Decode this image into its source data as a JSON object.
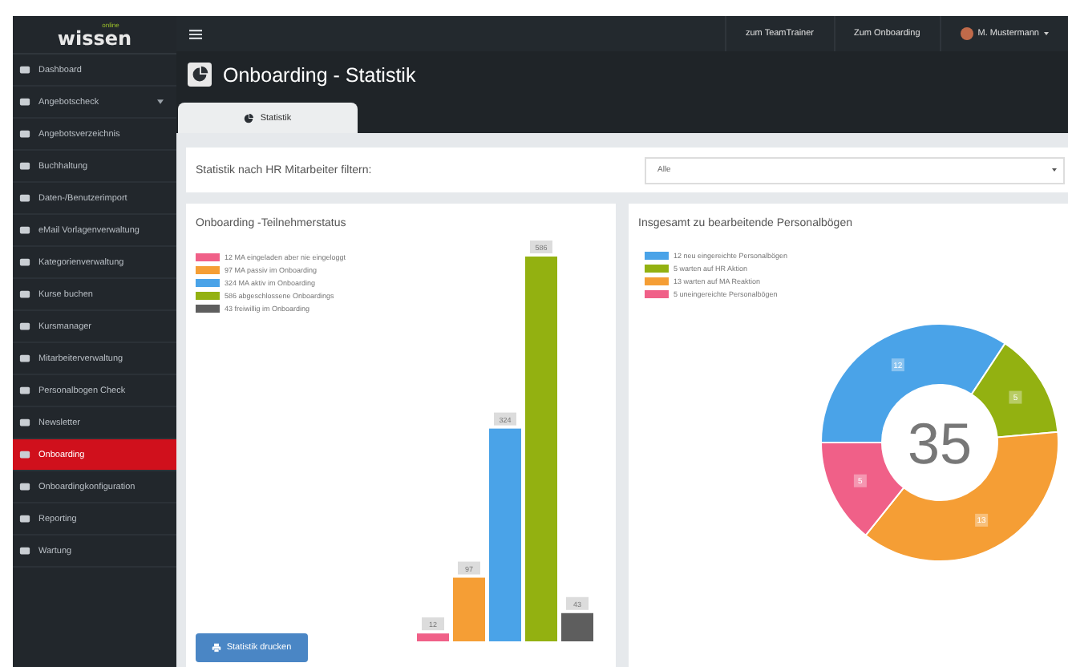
{
  "logo": {
    "small": "online",
    "text": "wissen"
  },
  "sidebar": {
    "items": [
      {
        "label": "Dashboard",
        "selected": false,
        "has_submenu": false
      },
      {
        "label": "Angebotscheck",
        "selected": false,
        "has_submenu": true
      },
      {
        "label": "Angebotsverzeichnis",
        "selected": false,
        "has_submenu": false
      },
      {
        "label": "Buchhaltung",
        "selected": false,
        "has_submenu": false
      },
      {
        "label": "Daten-/Benutzerimport",
        "selected": false,
        "has_submenu": false
      },
      {
        "label": "eMail Vorlagenverwaltung",
        "selected": false,
        "has_submenu": false
      },
      {
        "label": "Kategorienverwaltung",
        "selected": false,
        "has_submenu": false
      },
      {
        "label": "Kurse buchen",
        "selected": false,
        "has_submenu": false
      },
      {
        "label": "Kursmanager",
        "selected": false,
        "has_submenu": false
      },
      {
        "label": "Mitarbeiterverwaltung",
        "selected": false,
        "has_submenu": false
      },
      {
        "label": "Personalbogen Check",
        "selected": false,
        "has_submenu": false
      },
      {
        "label": "Newsletter",
        "selected": false,
        "has_submenu": false
      },
      {
        "label": "Onboarding",
        "selected": true,
        "has_submenu": false
      },
      {
        "label": "Onboardingkonfiguration",
        "selected": false,
        "has_submenu": false
      },
      {
        "label": "Reporting",
        "selected": false,
        "has_submenu": false
      },
      {
        "label": "Wartung",
        "selected": false,
        "has_submenu": false
      }
    ]
  },
  "topbar": {
    "links": [
      "zum TeamTrainer",
      "Zum Onboarding"
    ],
    "user": "M. Mustermann"
  },
  "page_title": "Onboarding - Statistik",
  "tabs": [
    {
      "label": "Statistik",
      "selected": true
    }
  ],
  "filter": {
    "label": "Statistik nach HR Mitarbeiter filtern:",
    "value": "Alle"
  },
  "participants": {
    "title": "Onboarding -Teilnehmerstatus",
    "print_button": "Statistik drucken",
    "chart_data": {
      "type": "bar",
      "data_labels": true,
      "series": [
        {
          "name": "12 MA eingeladen aber nie eingeloggt",
          "color": "#f06088",
          "values": [
            12
          ]
        },
        {
          "name": "97 MA passiv im Onboarding",
          "color": "#f59e35",
          "values": [
            97
          ]
        },
        {
          "name": "324 MA aktiv im Onboarding",
          "color": "#4aa3e8",
          "values": [
            324
          ]
        },
        {
          "name": "586 abgeschlossene Onboardings",
          "color": "#93b111",
          "values": [
            586
          ]
        },
        {
          "name": "43 freiwillig im Onboarding",
          "color": "#5e5e5e",
          "values": [
            43
          ]
        }
      ]
    }
  },
  "forms": {
    "title": "Insgesamt zu bearbeitende Personalbögen",
    "center_label": "35",
    "slices": [
      {
        "color": "#4aa3e8"
      },
      {
        "color": "#93b111"
      },
      {
        "color": "#f59e35"
      },
      {
        "color": "#f06088"
      }
    ],
    "chart_data": {
      "type": "donut",
      "data_labels": true,
      "categories": [
        "12 neu eingereichte Personalbögen",
        "5 warten  auf HR Aktion",
        "13 warten  auf MA Reaktion",
        "5 uneingereichte Personalbögen"
      ],
      "values": [
        12,
        5,
        13,
        5
      ]
    }
  }
}
